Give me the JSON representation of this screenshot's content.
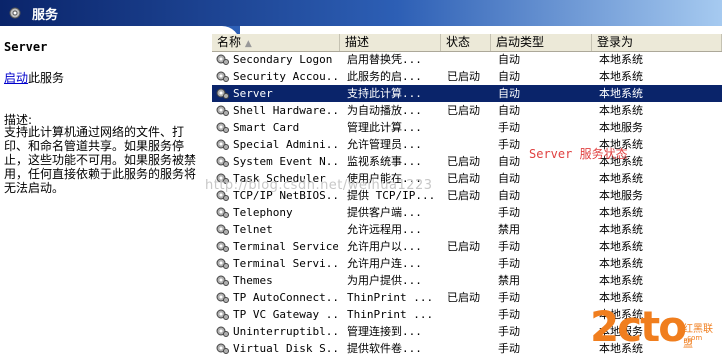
{
  "window": {
    "title": "服务"
  },
  "left_pane": {
    "service_title": "Server",
    "start_link": "启动",
    "start_suffix": "此服务",
    "description_label": "描述:",
    "description_text": "支持此计算机通过网络的文件、打印、和命名管道共享。如果服务停止，这些功能不可用。如果服务被禁用，任何直接依赖于此服务的服务将无法启动。"
  },
  "table": {
    "columns": [
      "名称",
      "描述",
      "状态",
      "启动类型",
      "登录为"
    ],
    "rows": [
      {
        "name": "Secondary Logon",
        "desc": "启用替换凭...",
        "status": "",
        "startup": "自动",
        "logon": "本地系统"
      },
      {
        "name": "Security Accou...",
        "desc": "此服务的启...",
        "status": "已启动",
        "startup": "自动",
        "logon": "本地系统"
      },
      {
        "name": "Server",
        "desc": "支持此计算...",
        "status": "",
        "startup": "自动",
        "logon": "本地系统"
      },
      {
        "name": "Shell Hardware...",
        "desc": "为自动播放...",
        "status": "已启动",
        "startup": "自动",
        "logon": "本地系统"
      },
      {
        "name": "Smart Card",
        "desc": "管理此计算...",
        "status": "",
        "startup": "手动",
        "logon": "本地服务"
      },
      {
        "name": "Special Admini...",
        "desc": "允许管理员...",
        "status": "",
        "startup": "手动",
        "logon": "本地系统"
      },
      {
        "name": "System Event N...",
        "desc": "监视系统事...",
        "status": "已启动",
        "startup": "自动",
        "logon": "本地系统"
      },
      {
        "name": "Task Scheduler",
        "desc": "使用户能在...",
        "status": "已启动",
        "startup": "自动",
        "logon": "本地系统"
      },
      {
        "name": "TCP/IP NetBIOS...",
        "desc": "提供 TCP/IP...",
        "status": "已启动",
        "startup": "自动",
        "logon": "本地服务"
      },
      {
        "name": "Telephony",
        "desc": "提供客户端...",
        "status": "",
        "startup": "手动",
        "logon": "本地系统"
      },
      {
        "name": "Telnet",
        "desc": "允许远程用...",
        "status": "",
        "startup": "禁用",
        "logon": "本地系统"
      },
      {
        "name": "Terminal Services",
        "desc": "允许用户以...",
        "status": "已启动",
        "startup": "手动",
        "logon": "本地系统"
      },
      {
        "name": "Terminal Servi...",
        "desc": "允许用户连...",
        "status": "",
        "startup": "手动",
        "logon": "本地系统"
      },
      {
        "name": "Themes",
        "desc": "为用户提供...",
        "status": "",
        "startup": "禁用",
        "logon": "本地系统"
      },
      {
        "name": "TP AutoConnect...",
        "desc": "ThinPrint ...",
        "status": "已启动",
        "startup": "手动",
        "logon": "本地系统"
      },
      {
        "name": "TP VC Gateway ...",
        "desc": "ThinPrint ...",
        "status": "",
        "startup": "手动",
        "logon": "本地系统"
      },
      {
        "name": "Uninterruptibl...",
        "desc": "管理连接到...",
        "status": "",
        "startup": "手动",
        "logon": "本地服务"
      },
      {
        "name": "Virtual Disk S...",
        "desc": "提供软件卷...",
        "status": "",
        "startup": "手动",
        "logon": "本地系统"
      }
    ]
  },
  "annotation": "Server 服务状态",
  "watermark": "http://blog.csdn.net/weihua1223",
  "logo": {
    "big": "2cto",
    "line1": "红黑联盟",
    "line2": ".com"
  },
  "colors": {
    "selection": "#0a246a",
    "annotation": "#e04040",
    "logo": "#f07e1e"
  }
}
